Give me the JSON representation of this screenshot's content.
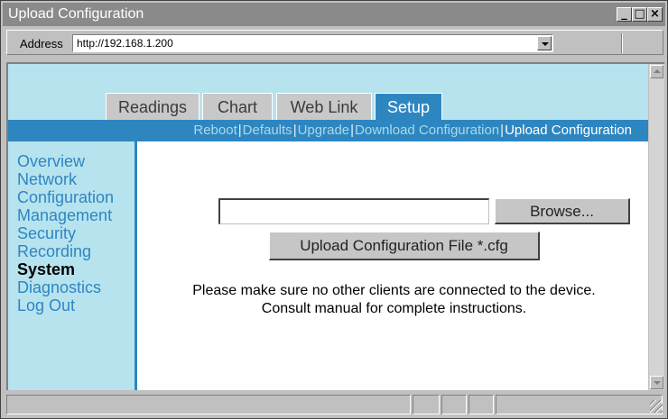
{
  "window": {
    "title": "Upload Configuration"
  },
  "address_bar": {
    "label": "Address",
    "url": "http://192.168.1.200"
  },
  "tabs": [
    {
      "label": "Readings"
    },
    {
      "label": "Chart"
    },
    {
      "label": "Web Link"
    },
    {
      "label": "Setup",
      "active": true
    }
  ],
  "subnav": [
    {
      "label": "Reboot"
    },
    {
      "label": "Defaults"
    },
    {
      "label": "Upgrade"
    },
    {
      "label": "Download Configuration"
    },
    {
      "label": "Upload Configuration",
      "current": true
    }
  ],
  "sidebar": [
    {
      "label": "Overview"
    },
    {
      "label": "Network"
    },
    {
      "label": "Configuration"
    },
    {
      "label": "Management"
    },
    {
      "label": "Security"
    },
    {
      "label": "Recording"
    },
    {
      "label": "System",
      "current": true
    },
    {
      "label": "Diagnostics"
    },
    {
      "label": "Log Out"
    }
  ],
  "main": {
    "file_input_value": "",
    "browse_label": "Browse...",
    "upload_label": "Upload Configuration File  *.cfg",
    "message_line1": "Please make sure no other clients are connected to the device.",
    "message_line2": "Consult manual for complete instructions."
  },
  "colors": {
    "accent": "#2e86c1",
    "light_band": "#b7e3ef",
    "inactive_tab": "#c8c8c8"
  }
}
